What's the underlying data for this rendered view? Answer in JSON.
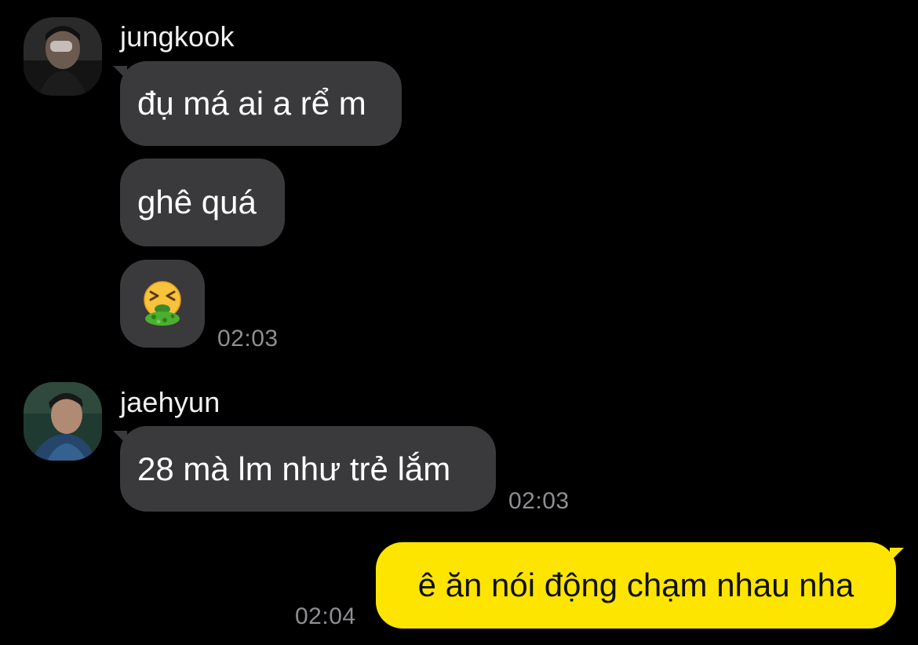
{
  "colors": {
    "background": "#000000",
    "incoming_bubble": "#3a3a3c",
    "outgoing_bubble": "#fee500",
    "timestamp": "#8e8e93"
  },
  "groups": [
    {
      "sender": "jungkook",
      "avatar_icon": "profile-photo-icon",
      "messages": [
        {
          "text": "đụ má ai a rể m"
        },
        {
          "text": "ghê quá"
        },
        {
          "emoji": "🤮",
          "emoji_icon": "face-vomiting-emoji-icon"
        }
      ],
      "time": "02:03"
    },
    {
      "sender": "jaehyun",
      "avatar_icon": "profile-photo-icon",
      "messages": [
        {
          "text": "28 mà lm như trẻ lắm"
        }
      ],
      "time": "02:03"
    }
  ],
  "outgoing": {
    "text": "ê ăn nói động chạm nhau nha",
    "time": "02:04"
  }
}
